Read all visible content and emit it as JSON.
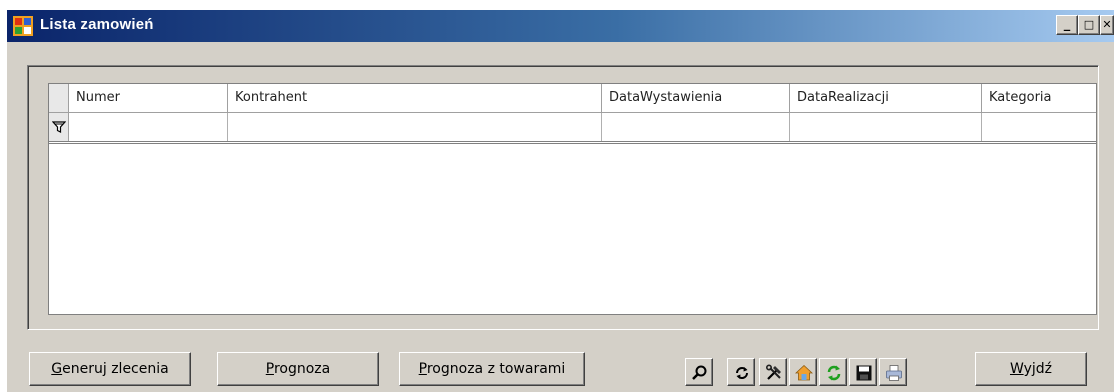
{
  "window": {
    "title": "Lista zamowień",
    "controls": {
      "minimize": "_",
      "maximize": "□",
      "close": "✕"
    }
  },
  "grid": {
    "columns": [
      "Numer",
      "Kontrahent",
      "DataWystawienia",
      "DataRealizacji",
      "Kategoria"
    ],
    "rows": [],
    "filter_icon": "filter-icon"
  },
  "buttons": {
    "generuj": {
      "mnemonic": "G",
      "rest": "eneruj zlecenia"
    },
    "prognoza": {
      "mnemonic": "P",
      "rest": "rognoza"
    },
    "prognoza_towary": {
      "mnemonic": "P",
      "rest": "rognoza z towarami"
    },
    "wyjdz": {
      "mnemonic": "W",
      "rest": "yjdź"
    }
  },
  "toolbar": {
    "icons": [
      "search-icon",
      "refresh-icon",
      "tools-icon",
      "home-icon",
      "sync-icon",
      "save-icon",
      "print-icon"
    ]
  }
}
